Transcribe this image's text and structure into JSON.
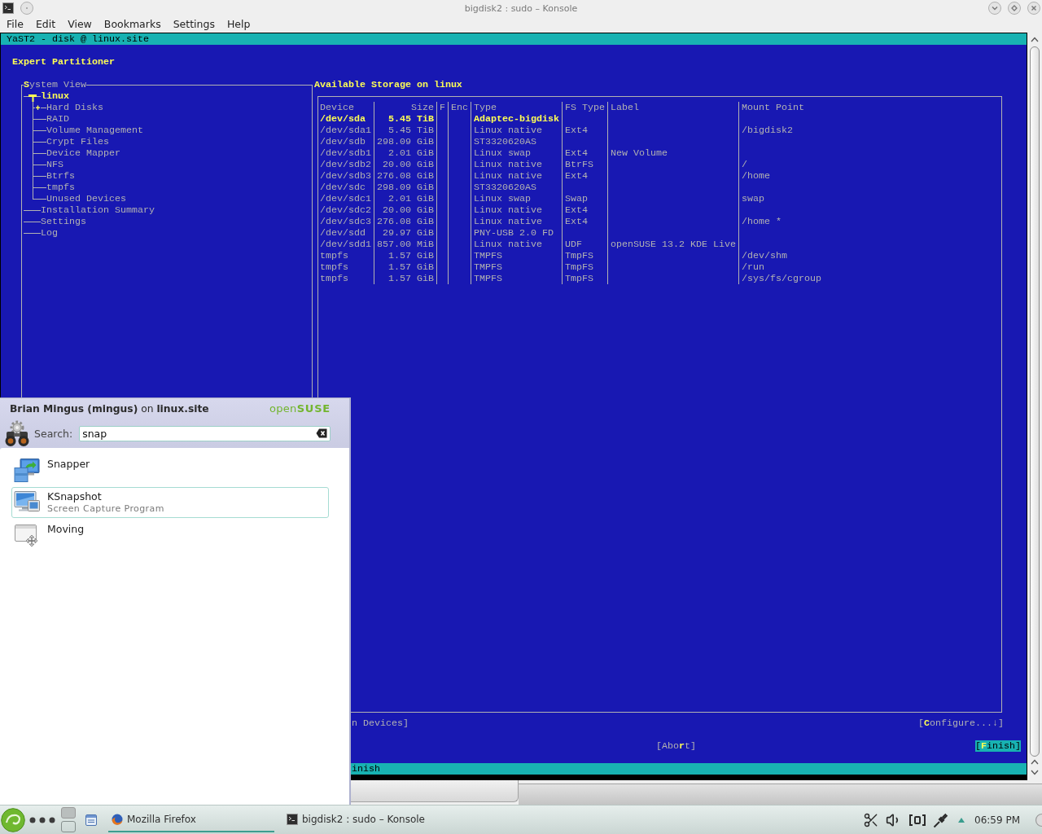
{
  "window": {
    "title": "bigdisk2 : sudo – Konsole"
  },
  "menu": [
    "File",
    "Edit",
    "View",
    "Bookmarks",
    "Settings",
    "Help"
  ],
  "terminal": {
    "title_bar": "YaST2 - disk @ linux.site",
    "heading": "Expert Partitioner",
    "system_view": {
      "title": "**S**ystem View",
      "tree": [
        {
          "label": "linux",
          "selected": true,
          "expanded": true,
          "children": [
            {
              "label": "Hard Disks",
              "selected": false,
              "expanded": false
            },
            {
              "label": "RAID",
              "selected": false
            },
            {
              "label": "Volume Management",
              "selected": false
            },
            {
              "label": "Crypt Files",
              "selected": false
            },
            {
              "label": "Device Mapper",
              "selected": false
            },
            {
              "label": "NFS",
              "selected": false
            },
            {
              "label": "Btrfs",
              "selected": false
            },
            {
              "label": "tmpfs",
              "selected": false
            },
            {
              "label": "Unused Devices",
              "selected": false
            }
          ]
        },
        {
          "label": "Installation Summary",
          "selected": false
        },
        {
          "label": "Settings",
          "selected": false
        },
        {
          "label": "Log",
          "selected": false
        }
      ]
    },
    "storage": {
      "title": "Available Storage on linux",
      "columns": [
        "Device",
        "Size",
        "F",
        "Enc",
        "Type",
        "FS Type",
        "Label",
        "Mount Point"
      ],
      "rows": [
        {
          "device": "/dev/sda",
          "size": "5.45 TiB",
          "type": "Adaptec-bigdisk",
          "selected": true
        },
        {
          "device": "/dev/sda1",
          "size": "5.45 TiB",
          "type": "Linux native",
          "fs_type": "Ext4",
          "mount_point": "/bigdisk2",
          "selected": false
        },
        {
          "device": "/dev/sdb",
          "size": "298.09 GiB",
          "type": "ST3320620AS",
          "selected": false
        },
        {
          "device": "/dev/sdb1",
          "size": "2.01 GiB",
          "type": "Linux swap",
          "fs_type": "Ext4",
          "label": "New Volume",
          "selected": false
        },
        {
          "device": "/dev/sdb2",
          "size": "20.00 GiB",
          "type": "Linux native",
          "fs_type": "BtrFS",
          "mount_point": "/",
          "selected": false
        },
        {
          "device": "/dev/sdb3",
          "size": "276.08 GiB",
          "type": "Linux native",
          "fs_type": "Ext4",
          "mount_point": "/home",
          "selected": false
        },
        {
          "device": "/dev/sdc",
          "size": "298.09 GiB",
          "type": "ST3320620AS",
          "selected": false
        },
        {
          "device": "/dev/sdc1",
          "size": "2.01 GiB",
          "type": "Linux swap",
          "fs_type": "Swap",
          "mount_point": "swap",
          "selected": false
        },
        {
          "device": "/dev/sdc2",
          "size": "20.00 GiB",
          "type": "Linux native",
          "fs_type": "Ext4",
          "selected": false
        },
        {
          "device": "/dev/sdc3",
          "size": "276.08 GiB",
          "type": "Linux native",
          "fs_type": "Ext4",
          "mount_point": "/home *",
          "selected": false
        },
        {
          "device": "/dev/sdd",
          "size": "29.97 GiB",
          "type": "PNY-USB 2.0 FD",
          "selected": false
        },
        {
          "device": "/dev/sdd1",
          "size": "857.00 MiB",
          "type": "Linux native",
          "fs_type": "UDF",
          "label": "openSUSE 13.2 KDE Live",
          "selected": false
        },
        {
          "device": "tmpfs",
          "size": "1.57 GiB",
          "type": "TMPFS",
          "fs_type": "TmpFS",
          "mount_point": "/dev/shm",
          "selected": false
        },
        {
          "device": "tmpfs",
          "size": "1.57 GiB",
          "type": "TMPFS",
          "fs_type": "TmpFS",
          "mount_point": "/run",
          "selected": false
        },
        {
          "device": "tmpfs",
          "size": "1.57 GiB",
          "type": "TMPFS",
          "fs_type": "TmpFS",
          "mount_point": "/sys/fs/cgroup",
          "selected": false
        }
      ]
    },
    "button_rows": [
      [
        {
          "label": "n Devices]",
          "focused": false
        },
        {
          "label": "[**C**onfigure...↓]",
          "focused": false
        }
      ],
      [
        {
          "label": "[Abo**r**t]",
          "focused": false
        },
        {
          "label": "[**F**inish]",
          "focused": true
        }
      ]
    ],
    "status_line": "inish"
  },
  "launcher": {
    "user": "**Brian Mingus (mingus)** on **linux.site**",
    "logo": "open**SUSE**",
    "search": {
      "label": "Search:",
      "value": "snap"
    },
    "results": [
      {
        "kind": "snapper",
        "title": "Snapper",
        "selected": false
      },
      {
        "kind": "screenshot",
        "title": "KSnapshot",
        "description": "Screen Capture Program",
        "selected": true
      },
      {
        "kind": "window",
        "title": "Moving",
        "selected": false
      }
    ]
  },
  "taskbar": {
    "desktops": [
      {
        "selected": true
      },
      {
        "selected": false
      }
    ],
    "tasks": [
      {
        "kind": "browser",
        "label": "Mozilla Firefox",
        "selected": true
      },
      {
        "kind": "terminal",
        "label": "bigdisk2 : sudo – Konsole",
        "selected": false
      }
    ],
    "clock": "06:59 PM"
  }
}
